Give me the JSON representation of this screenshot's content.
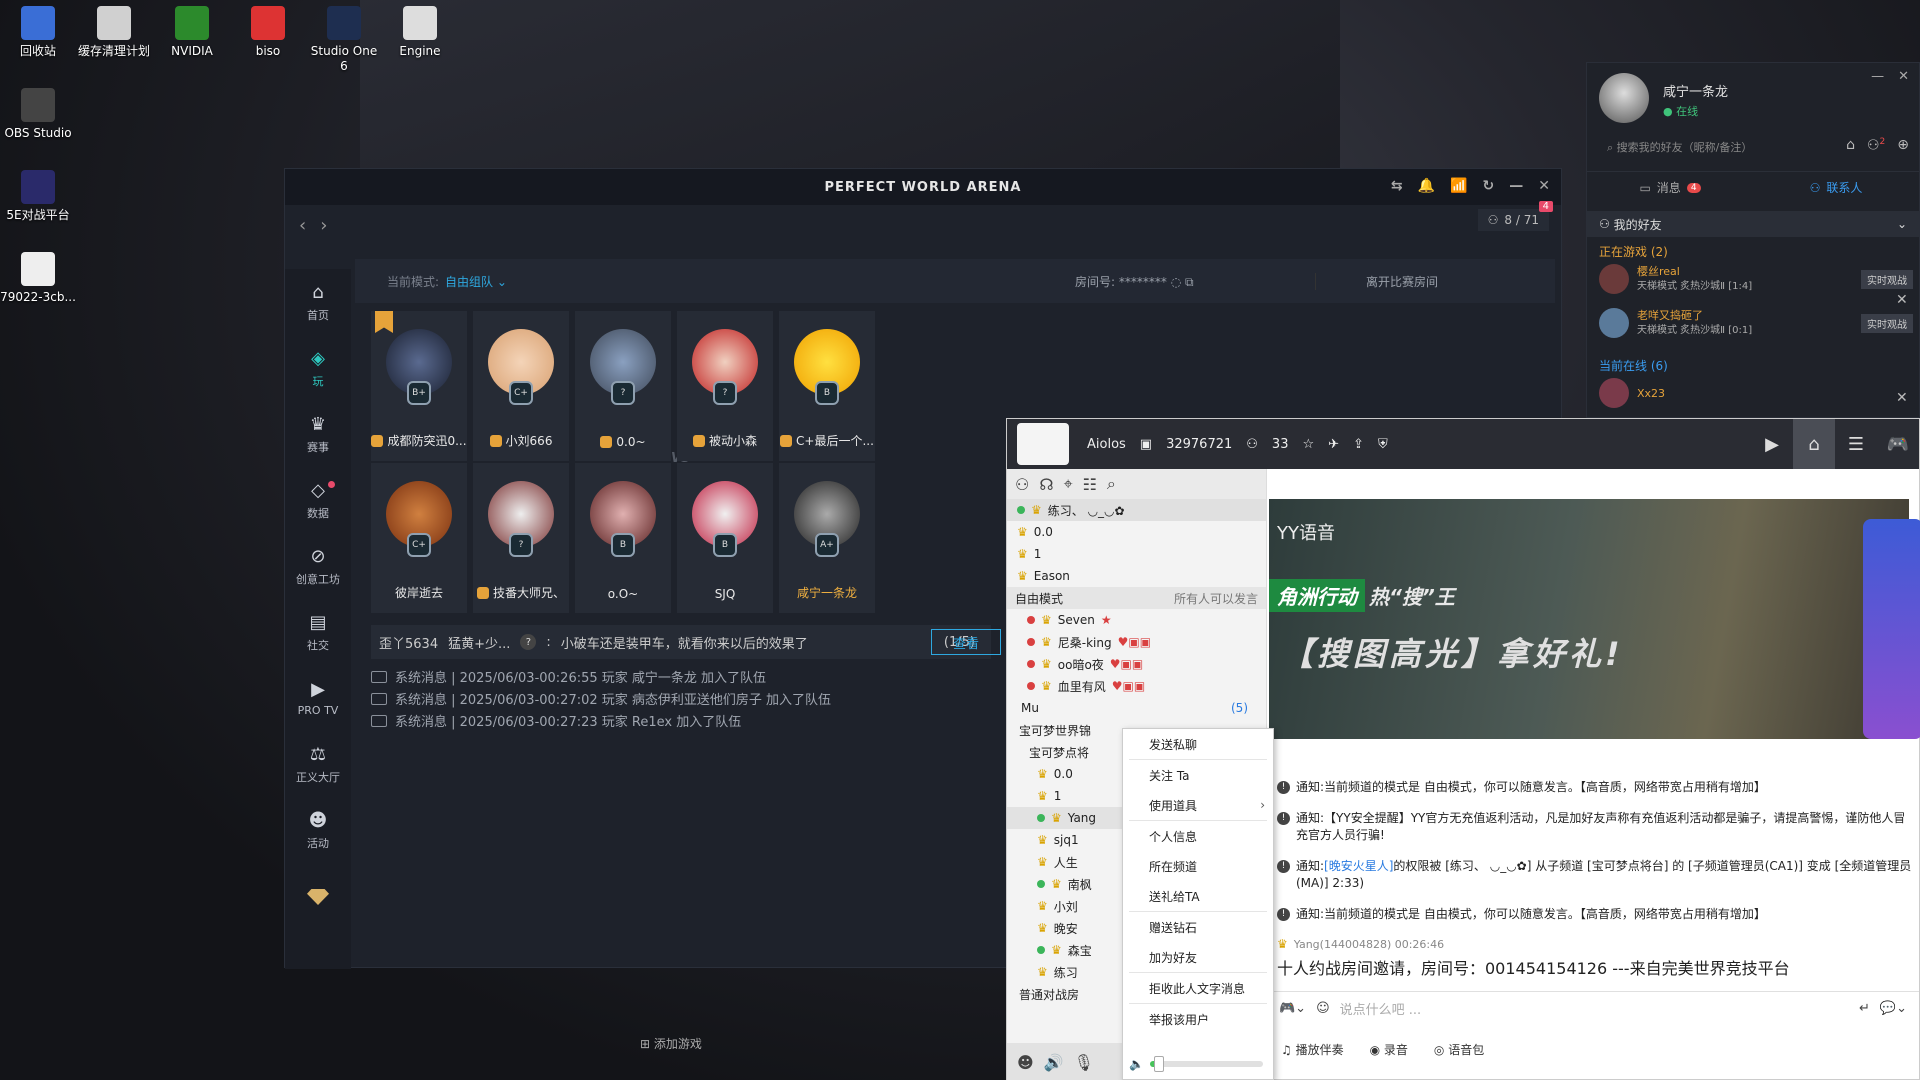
{
  "desktop": {
    "icons": [
      {
        "label": "回收站",
        "icon": "recycle-bin-icon"
      },
      {
        "label": "缓存清理计划",
        "icon": "cache-clean-icon"
      },
      {
        "label": "NVIDIA",
        "icon": "nvidia-icon"
      },
      {
        "label": "biso",
        "icon": "biso-icon"
      },
      {
        "label": "Studio One 6",
        "icon": "studio-one-icon"
      },
      {
        "label": "Engine",
        "icon": "engine-icon"
      },
      {
        "label": "OBS Studio",
        "icon": "obs-icon"
      },
      {
        "label": "5E对战平台",
        "icon": "5e-icon"
      },
      {
        "label": "79022-3cb...",
        "icon": "file-icon"
      }
    ]
  },
  "pwa": {
    "title": "PERFECT WORLD ARENA",
    "counter": "8 / 71",
    "counter_badge": "4",
    "sidebar": [
      {
        "label": "首页",
        "icon": "home-icon"
      },
      {
        "label": "玩",
        "icon": "play-icon"
      },
      {
        "label": "赛事",
        "icon": "trophy-icon"
      },
      {
        "label": "数据",
        "icon": "data-icon"
      },
      {
        "label": "创意工坊",
        "icon": "workshop-icon"
      },
      {
        "label": "社交",
        "icon": "social-icon"
      },
      {
        "label": "PRO TV",
        "icon": "tv-icon"
      },
      {
        "label": "正义大厅",
        "icon": "justice-icon"
      },
      {
        "label": "活动",
        "icon": "event-icon"
      }
    ],
    "mode_label": "当前模式:",
    "mode_value": "自由组队",
    "room_label": "房间号:",
    "room_value": "********",
    "leave_label": "离开比赛房间",
    "vs": "VS",
    "team1": [
      {
        "name": "成都防突迅0...",
        "rank": "B+"
      },
      {
        "name": "小刘666",
        "rank": "C+"
      },
      {
        "name": "0.0~",
        "rank": "?"
      },
      {
        "name": "被动小森",
        "rank": "?"
      },
      {
        "name": "C+最后一个...",
        "rank": "B"
      }
    ],
    "team2": [
      {
        "name": "彼岸逝去",
        "rank": "C+"
      },
      {
        "name": "技番大师兄、",
        "rank": "?"
      },
      {
        "name": "o.O~",
        "rank": "B"
      },
      {
        "name": "SJQ",
        "rank": "B"
      },
      {
        "name": "咸宁一条龙",
        "rank": "A+"
      }
    ],
    "chat": {
      "sender": "歪丫5634",
      "tag": "猛黄+少...",
      "q": "?",
      "sep": ":",
      "text": "小破车还是装甲车，就看你来以后的效果了",
      "count": "(1/5)",
      "view": "查看"
    },
    "system_messages": [
      "系统消息 | 2025/06/03-00:26:55 玩家 咸宁一条龙 加入了队伍",
      "系统消息 | 2025/06/03-00:27:02 玩家 病态伊利亚送他们房子 加入了队伍",
      "系统消息 | 2025/06/03-00:27:23 玩家 Re1ex  加入了队伍"
    ],
    "add_game": "添加游戏"
  },
  "yy": {
    "channel_name": "Aiolos",
    "channel_id": "32976721",
    "online": "33",
    "top_users": [
      "练习、 ◡_◡✿",
      "0.0",
      "1",
      "Eason"
    ],
    "mode_left": "自由模式",
    "mode_right": "所有人可以发言",
    "mode_users": [
      "Seven",
      "尼桑-king",
      "oo暗o夜",
      "血里有风"
    ],
    "sub_label": "Mu",
    "sub_count": "(5)",
    "channels": [
      "宝可梦世界锦",
      "宝可梦点将"
    ],
    "sub_users": [
      "0.0",
      "1",
      "Yang",
      "sjq1",
      "人生",
      "南枫",
      "小刘",
      "晚安",
      "森宝",
      "练习"
    ],
    "normal_room": "普通对战房",
    "banner_brand": "YY语音",
    "banner_tag": "角洲行动",
    "banner_tag2": "热“搜”王",
    "banner_main": "【搜图高光】拿好礼!",
    "messages": [
      {
        "prefix": "通知:",
        "text": "当前频道的模式是 自由模式，你可以随意发言。【高音质，网络带宽占用稍有增加】"
      },
      {
        "prefix": "通知:",
        "text": "【YY安全提醒】YY官方无充值返利活动，凡是加好友声称有充值返利活动都是骗子，请提高警惕，谨防他人冒充官方人员行骗!"
      },
      {
        "prefix": "通知:",
        "link": "[晚安火星人]",
        "text": "的权限被 [练习、 ◡_◡✿] 从子频道 [宝可梦点将台] 的 [子频道管理员(CA1)] 变成 [全频道管理员(MA)] 2:33)"
      },
      {
        "prefix": "通知:",
        "text": "当前频道的模式是 自由模式，你可以随意发言。【高音质，网络带宽占用稍有增加】"
      }
    ],
    "invite_header": "Yang(144004828) 00:26:46",
    "invite_text": "十人约战房间邀请，房间号：001454154126 ---来自完美世界竞技平台",
    "input_placeholder": "说点什么吧 ...",
    "actions": [
      "播放伴奏",
      "录音",
      "语音包"
    ]
  },
  "context_menu": {
    "items": [
      "发送私聊",
      "关注 Ta",
      "使用道具",
      "个人信息",
      "所在频道",
      "送礼给TA",
      "赠送钻石",
      "加为好友",
      "拒收此人文字消息",
      "举报该用户"
    ],
    "volume": 0.08
  },
  "qq": {
    "name": "咸宁一条龙",
    "status": "在线",
    "search_placeholder": "搜索我的好友（昵称/备注）",
    "notif_badge": "2",
    "tab_messages": "消息",
    "tab_messages_badge": "4",
    "tab_contacts": "联系人",
    "group": "我的好友",
    "in_game": "正在游戏 (2)",
    "friends": [
      {
        "name": "樱丝real",
        "detail": "天梯模式 炙热沙城Ⅱ [1:4]",
        "action": "实时观战"
      },
      {
        "name": "老咩又捣砸了",
        "detail": "天梯模式 炙热沙城Ⅱ [0:1]",
        "action": "实时观战"
      }
    ],
    "online": "当前在线 (6)",
    "online_first": "Xx23"
  }
}
